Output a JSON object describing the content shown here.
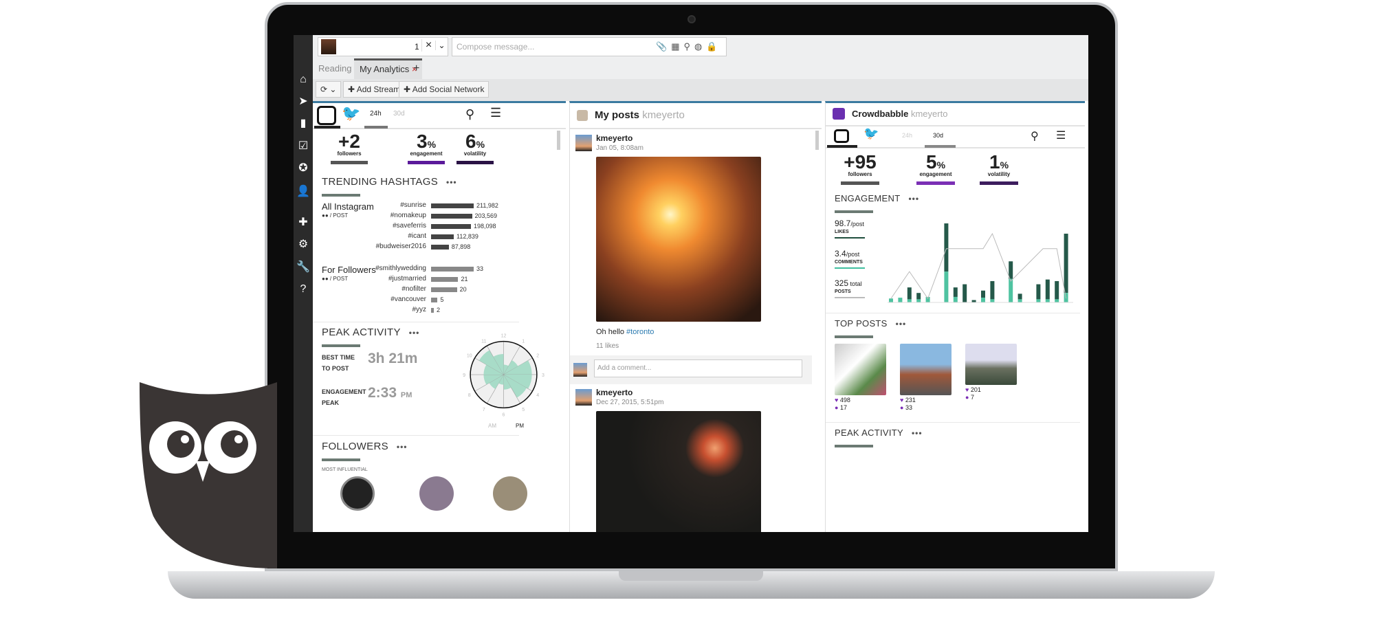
{
  "topbar": {
    "profile_count": "1",
    "compose_placeholder": "Compose message..."
  },
  "tabs": [
    {
      "label": "Reading"
    },
    {
      "label": "My Analytics"
    }
  ],
  "toolbar": {
    "add_stream": "Add Stream",
    "add_social_network": "Add Social Network"
  },
  "sidebar_icons": [
    "home-icon",
    "send-icon",
    "analytics-icon",
    "assignments-icon",
    "contests-icon",
    "contacts-icon",
    "apps-icon",
    "settings-icon",
    "tools-icon",
    "help-icon"
  ],
  "col1": {
    "time_tabs": [
      "24h",
      "30d"
    ],
    "selected_time": "24h",
    "stats": [
      {
        "value": "+2",
        "unit": "",
        "label": "followers",
        "color": "#555555"
      },
      {
        "value": "3",
        "unit": "%",
        "label": "engagement",
        "color": "#5b1a9a"
      },
      {
        "value": "6",
        "unit": "%",
        "label": "volatility",
        "color": "#2a1245"
      }
    ],
    "trending_title": "TRENDING HASHTAGS",
    "all_instagram": {
      "title": "All Instagram",
      "sub": "/ POST",
      "tags": [
        {
          "tag": "#sunrise",
          "value": "211,982",
          "n": 211982
        },
        {
          "tag": "#nomakeup",
          "value": "203,569",
          "n": 203569
        },
        {
          "tag": "#saveferris",
          "value": "198,098",
          "n": 198098
        },
        {
          "tag": "#icant",
          "value": "112,839",
          "n": 112839
        },
        {
          "tag": "#budweiser2016",
          "value": "87,898",
          "n": 87898
        }
      ]
    },
    "for_followers": {
      "title": "For Followers",
      "sub": "/ POST",
      "tags": [
        {
          "tag": "#smithlywedding",
          "value": "33",
          "n": 33
        },
        {
          "tag": "#justmarried",
          "value": "21",
          "n": 21
        },
        {
          "tag": "#nofilter",
          "value": "20",
          "n": 20
        },
        {
          "tag": "#vancouver",
          "value": "5",
          "n": 5
        },
        {
          "tag": "#yyz",
          "value": "2",
          "n": 2
        }
      ]
    },
    "peak_title": "PEAK ACTIVITY",
    "best_time_label_1": "BEST TIME",
    "best_time_label_2": "TO POST",
    "best_time": "3h 21m",
    "engagement_peak_label_1": "ENGAGEMENT",
    "engagement_peak_label_2": "PEAK",
    "engagement_peak": "2:33",
    "engagement_peak_ampm": "PM",
    "clock_hours": [
      "12",
      "1",
      "2",
      "3",
      "4",
      "5",
      "6",
      "7",
      "8",
      "9",
      "10",
      "11"
    ],
    "clock_values": [
      0.3,
      0.5,
      0.85,
      0.85,
      0.8,
      0.45,
      0.3,
      0.5,
      0.6,
      0.6,
      0.85,
      0.62
    ],
    "am": "AM",
    "pm": "PM",
    "followers_title": "FOLLOWERS",
    "most_influential": "MOST INFLUENTIAL"
  },
  "col2": {
    "title": "My posts",
    "user": "kmeyerto",
    "posts": [
      {
        "user": "kmeyerto",
        "date": "Jan 05, 8:08am",
        "caption": "Oh hello ",
        "hashtag": "#toronto",
        "likes": "11 likes"
      },
      {
        "user": "kmeyerto",
        "date": "Dec 27, 2015, 5:51pm"
      }
    ],
    "comment_placeholder": "Add a comment..."
  },
  "col3": {
    "title": "Crowdbabble",
    "user": "kmeyerto",
    "time_tabs": [
      "24h",
      "30d"
    ],
    "selected_time": "30d",
    "stats": [
      {
        "value": "+95",
        "unit": "",
        "label": "followers",
        "color": "#555555"
      },
      {
        "value": "5",
        "unit": "%",
        "label": "engagement",
        "color": "#7b2fb5"
      },
      {
        "value": "1",
        "unit": "%",
        "label": "volatility",
        "color": "#3d1d5e"
      }
    ],
    "engagement_title": "ENGAGEMENT",
    "likes": {
      "value": "98.7",
      "unit": "/post",
      "label": "LIKES",
      "color": "#1f4e3d"
    },
    "comments": {
      "value": "3.4",
      "unit": "/post",
      "label": "COMMENTS",
      "color": "#3fbf9f"
    },
    "posts": {
      "value": "325",
      "unit": " total",
      "label": "POSTS",
      "color": "#bbbbbb"
    },
    "top_posts_title": "TOP POSTS",
    "top_posts": [
      {
        "likes": "498",
        "comments": "17"
      },
      {
        "likes": "231",
        "comments": "33"
      },
      {
        "likes": "201",
        "comments": "7"
      }
    ],
    "peak_title": "PEAK ACTIVITY"
  },
  "chart_data": {
    "type": "bar",
    "stacked": true,
    "series": [
      {
        "values": [
          5,
          6,
          19,
          12,
          7,
          0,
          100,
          19,
          23,
          3,
          15,
          27,
          0,
          52,
          11,
          0,
          23,
          29,
          27,
          87
        ],
        "color": "#25594a"
      },
      {
        "values": [
          5,
          6,
          4,
          4,
          7,
          0,
          39,
          7,
          0,
          0,
          6,
          4,
          0,
          30,
          4,
          0,
          4,
          4,
          4,
          12
        ],
        "color": "#4fc3a1"
      }
    ],
    "line": {
      "x": [
        0,
        2,
        4,
        6,
        10,
        11,
        13,
        16.5,
        18,
        19
      ],
      "y": [
        5,
        39,
        5,
        68,
        68,
        87,
        27,
        68,
        68,
        5
      ],
      "color": "#bbbbbb"
    }
  }
}
